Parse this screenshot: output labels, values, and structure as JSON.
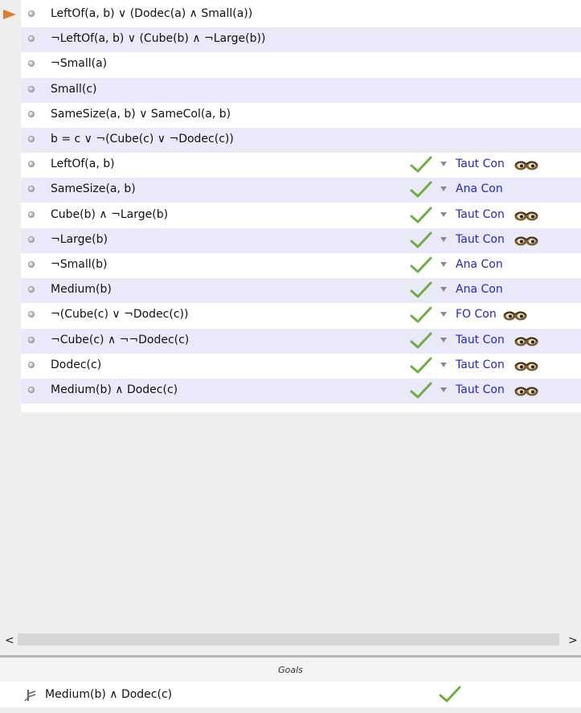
{
  "colors": {
    "rule_link": "#2424d6",
    "check_green": "#6fae3c",
    "pointer": "#e07a2e",
    "shaded_row": "#e9e9fa"
  },
  "proof": {
    "premises": [
      "LeftOf(a, b) ∨ (Dodec(a) ∧ Small(a))",
      "¬LeftOf(a, b) ∨ (Cube(b) ∧ ¬Large(b))",
      "¬Small(a)",
      "Small(c)",
      "SameSize(a, b) ∨ SameCol(a, b)",
      "b = c ∨ ¬(Cube(c) ∨ ¬Dodec(c))"
    ],
    "steps": [
      {
        "sentence": "LeftOf(a, b)",
        "rule": "Taut Con",
        "eyes": true
      },
      {
        "sentence": "SameSize(a, b)",
        "rule": "Ana Con",
        "eyes": false
      },
      {
        "sentence": "Cube(b) ∧ ¬Large(b)",
        "rule": "Taut Con",
        "eyes": true
      },
      {
        "sentence": "¬Large(b)",
        "rule": "Taut Con",
        "eyes": true
      },
      {
        "sentence": "¬Small(b)",
        "rule": "Ana Con",
        "eyes": false
      },
      {
        "sentence": "Medium(b)",
        "rule": "Ana Con",
        "eyes": false
      },
      {
        "sentence": "¬(Cube(c) ∨ ¬Dodec(c))",
        "rule": "FO Con",
        "eyes": true
      },
      {
        "sentence": "¬Cube(c) ∧ ¬¬Dodec(c)",
        "rule": "Taut Con",
        "eyes": true
      },
      {
        "sentence": "Dodec(c)",
        "rule": "Taut Con",
        "eyes": true
      },
      {
        "sentence": "Medium(b) ∧ Dodec(c)",
        "rule": "Taut Con",
        "eyes": true
      }
    ]
  },
  "scrollbar": {
    "left_arrow": "<",
    "right_arrow": ">"
  },
  "goals": {
    "title": "Goals",
    "items": [
      {
        "sentence": "Medium(b) ∧ Dodec(c)",
        "status": "check-icon"
      }
    ]
  }
}
